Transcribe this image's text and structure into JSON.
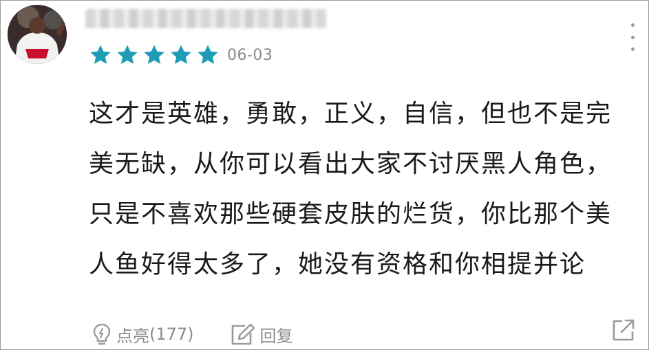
{
  "comment": {
    "date": "06-03",
    "stars": 5,
    "star_color": "#1e9cb5",
    "lines": [
      "这才是英雄，勇敢，正义，自信，但也不是完",
      "美无缺，从你可以看出大家不讨厌黑人角色，",
      "只是不喜欢那些硬套皮肤的烂货，你比那个美",
      "人鱼好得太多了，她没有资格和你相提并论"
    ]
  },
  "actions": {
    "like_label": "点亮",
    "like_count": "(177)",
    "reply_label": "回复"
  },
  "icons": {
    "more": "more-vertical-icon",
    "like": "lightbulb-icon",
    "reply": "edit-icon",
    "share": "share-external-icon"
  }
}
